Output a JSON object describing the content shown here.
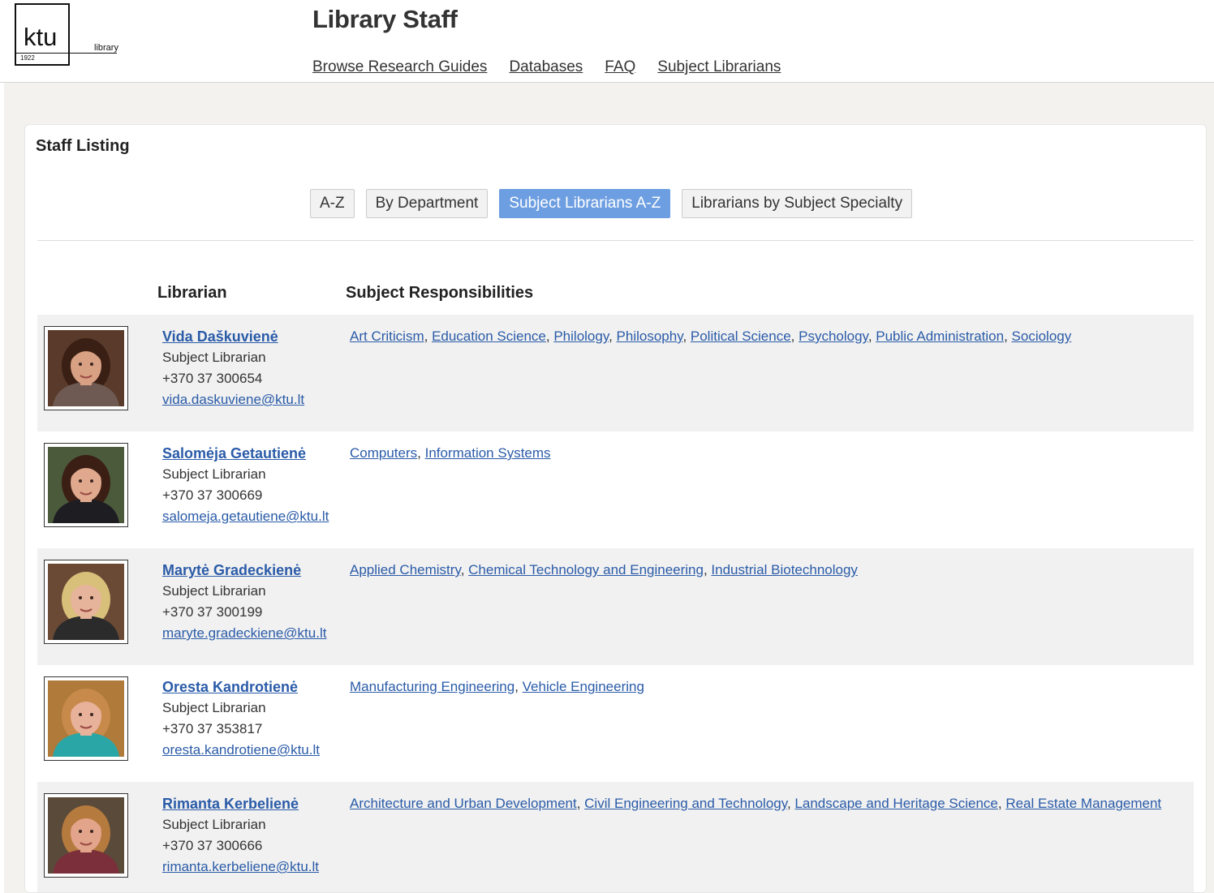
{
  "brand": {
    "logo_text": "ktu",
    "logo_year": "1922",
    "logo_sub": "library"
  },
  "header": {
    "title": "Library Staff",
    "nav": [
      "Browse Research Guides",
      "Databases",
      "FAQ",
      "Subject Librarians"
    ]
  },
  "panel": {
    "title": "Staff Listing",
    "filters": [
      {
        "label": "A-Z",
        "active": false
      },
      {
        "label": "By Department",
        "active": false
      },
      {
        "label": "Subject Librarians A-Z",
        "active": true
      },
      {
        "label": "Librarians by Subject Specialty",
        "active": false
      }
    ],
    "columns": {
      "librarian": "Librarian",
      "subjects": "Subject Responsibilities"
    }
  },
  "colors": {
    "link": "#2a5ba8",
    "active_button": "#6d9ee1",
    "row_stripe": "#f1f1f1",
    "band": "#f3f2ef"
  },
  "librarians": [
    {
      "name": "Vida Daškuvienė",
      "role": "Subject Librarian",
      "phone": "+370 37 300654",
      "email": "vida.daskuviene@ktu.lt",
      "subjects": [
        "Art Criticism",
        "Education Science",
        "Philology",
        "Philosophy",
        "Political Science",
        "Psychology",
        "Public Administration",
        "Sociology"
      ],
      "photo": {
        "bg": "#5a3a2a",
        "hair": "#3a1f14",
        "skin": "#d9a184",
        "shirt": "#6e5a52"
      }
    },
    {
      "name": "Salomėja Getautienė",
      "role": "Subject Librarian",
      "phone": "+370 37 300669",
      "email": "salomeja.getautiene@ktu.lt",
      "subjects": [
        "Computers",
        "Information Systems"
      ],
      "photo": {
        "bg": "#4a5a3a",
        "hair": "#3b1e14",
        "skin": "#e0a98e",
        "shirt": "#1d1d22"
      }
    },
    {
      "name": "Marytė Gradeckienė",
      "role": "Subject Librarian",
      "phone": "+370 37 300199",
      "email": "maryte.gradeckiene@ktu.lt",
      "subjects": [
        "Applied Chemistry",
        "Chemical Technology and Engineering",
        "Industrial Biotechnology"
      ],
      "photo": {
        "bg": "#6a4a35",
        "hair": "#d8bf7a",
        "skin": "#e6b49a",
        "shirt": "#2b2b2b"
      }
    },
    {
      "name": "Oresta Kandrotienė",
      "role": "Subject Librarian",
      "phone": "+370 37 353817",
      "email": "oresta.kandrotiene@ktu.lt",
      "subjects": [
        "Manufacturing Engineering",
        "Vehicle Engineering"
      ],
      "photo": {
        "bg": "#b07a3a",
        "hair": "#c78a4a",
        "skin": "#e8b19a",
        "shirt": "#2aa6a6"
      }
    },
    {
      "name": "Rimanta Kerbelienė",
      "role": "Subject Librarian",
      "phone": "+370 37 300666",
      "email": "rimanta.kerbeliene@ktu.lt",
      "subjects": [
        "Architecture and Urban Development",
        "Civil Engineering and Technology",
        "Landscape and Heritage Science",
        "Real Estate Management"
      ],
      "photo": {
        "bg": "#5a4a3a",
        "hair": "#b57a3e",
        "skin": "#e2a48a",
        "shirt": "#7a2f3a"
      }
    }
  ]
}
